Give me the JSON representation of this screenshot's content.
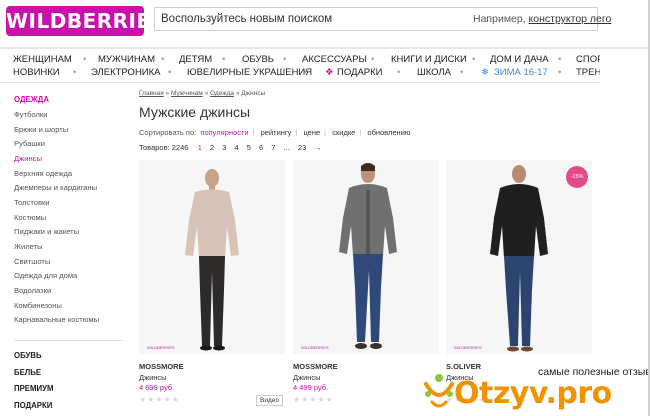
{
  "header": {
    "logo": "WILDBERRIES",
    "search_placeholder": "Воспользуйтесь новым поиском",
    "search_hint_prefix": "Например, ",
    "search_hint_link": "конструктор лего"
  },
  "nav_row1": [
    "ЖЕНЩИНАМ",
    "МУЖЧИНАМ",
    "ДЕТЯМ",
    "ОБУВЬ",
    "АКСЕССУАРЫ",
    "КНИГИ И ДИСКИ",
    "ДОМ И ДАЧА",
    "СПОР"
  ],
  "nav_row2": [
    "НОВИНКИ",
    "ЭЛЕКТРОНИКА",
    "ЮВЕЛИРНЫЕ УКРАШЕНИЯ",
    "ПОДАРКИ",
    "ШКОЛА",
    "ЗИМА 16-17",
    "ТРЕН"
  ],
  "sidebar": {
    "head": "ОДЕЖДА",
    "items": [
      "Футболки",
      "Брюки и шорты",
      "Рубашки",
      "Джинсы",
      "Верхняя одежда",
      "Джемперы и кардиганы",
      "Толстовки",
      "Костюмы",
      "Пиджаки и жакеты",
      "Жилеты",
      "Свитшоты",
      "Одежда для дома",
      "Водолазки",
      "Комбинезоны",
      "Карнавальные костюмы"
    ],
    "sections": [
      "ОБУВЬ",
      "БЕЛЬЕ",
      "ПРЕМИУМ",
      "ПОДАРКИ"
    ]
  },
  "breadcrumb": [
    "Главная",
    "Мужчинам",
    "Одежда",
    "Джинсы"
  ],
  "page_title": "Мужские джинсы",
  "sort": {
    "label": "Сортировать по:",
    "options": [
      "популярности",
      "рейтингу",
      "цене",
      "скидке",
      "обновлению"
    ]
  },
  "pager": {
    "count_label": "Товаров: 2246",
    "pages": [
      "1",
      "2",
      "3",
      "4",
      "5",
      "6",
      "7",
      "...",
      "23",
      "→"
    ]
  },
  "products": [
    {
      "brand": "MOSSMORE",
      "type": "Джинсы",
      "price": "4 699 руб.",
      "stars": "★★★★★",
      "video": "Видео"
    },
    {
      "brand": "MOSSMORE",
      "type": "Джинсы",
      "price": "4 499 руб.",
      "stars": "★★★★★"
    },
    {
      "brand": "S.OLIVER",
      "type": "Джинсы",
      "price": "",
      "stars": "★★★★★",
      "discount": "-15%"
    }
  ],
  "watermark_text": "WILDBERRIES",
  "otzyv": {
    "tagline": "самые полезные отзывы",
    "logo": "Otzyv.pro"
  },
  "colors": {
    "brand": "#cb11ab",
    "accent_orange": "#f39200"
  }
}
